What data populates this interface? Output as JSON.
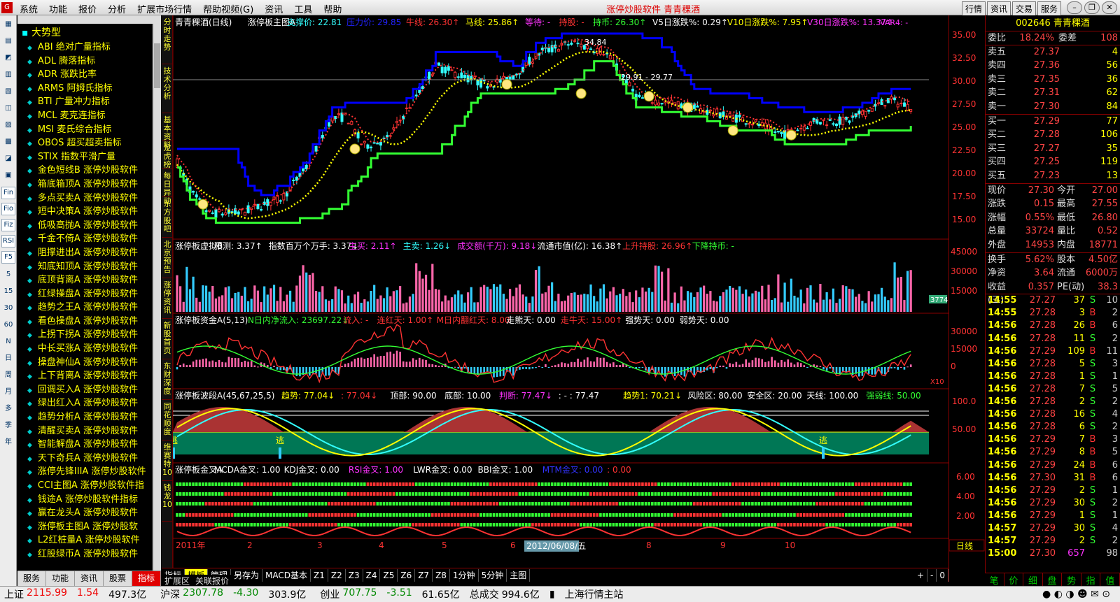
{
  "app": {
    "title": "涨停炒股软件   青青稞酒",
    "menu": [
      "系统",
      "功能",
      "报价",
      "分析",
      "扩展市场行情",
      "帮助视频(G)",
      "资讯",
      "工具",
      "帮助"
    ],
    "right_buttons": [
      "行情",
      "资讯",
      "交易",
      "服务"
    ]
  },
  "sidebar": {
    "header": "大势型",
    "items": [
      "ABI 绝对广量指标",
      "ADL 腾落指标",
      "ADR 涨跌比率",
      "ARMS 阿姆氏指标",
      "BTI 广量冲力指标",
      "MCL 麦克连指标",
      "MSI 麦氏综合指标",
      "OBOS 超买超卖指标",
      "STIX 指数平滑广量",
      "金色短线B 涨停炒股软件",
      "箱底箱顶A 涨停炒股软件",
      "多点买卖A 涨停炒股软件",
      "短中决策A 涨停炒股软件",
      "低吸高抛A 涨停炒股软件",
      "千金不倚A 涨停炒股软件",
      "阻撑进出A 涨停炒股软件",
      "知底知顶A 涨停炒股软件",
      "底顶背离A 涨停炒股软件",
      "红绿操盘A 涨停炒股软件",
      "趋势之王A 涨停炒股软件",
      "看色操盘A 涨停炒股软件",
      "上拐下拐A 涨停炒股软件",
      "中长买涨A 涨停炒股软件",
      "操盘神仙A 涨停炒股软件",
      "上下背离A 涨停炒股软件",
      "回调买入A 涨停炒股软件",
      "绿出红入A 涨停炒股软件",
      "趋势分析A 涨停炒股软件",
      "清醒买卖A 涨停炒股软件",
      "智能解盘A 涨停炒股软件",
      "天下奇兵A 涨停炒股软件",
      "涨停先锋IIIA 涨停炒股软件",
      "CCI主图A 涨停炒股软件指",
      "钱途A 涨停炒股软件指标",
      "赢在龙头A 涨停炒股软件",
      "涨停板主图A 涨停炒股软",
      "L2红桩量A 涨停炒股软件",
      "红股绿币A 涨停炒股软件"
    ],
    "tabs": [
      "服务",
      "功能",
      "资讯",
      "股票",
      "指标"
    ],
    "active_tab": "指标"
  },
  "toolbar": [
    "Fin",
    "Fio",
    "Fiz",
    "RSI",
    "F5",
    "5",
    "15",
    "30",
    "60",
    "N",
    "日",
    "周",
    "月",
    "多",
    "季",
    "年"
  ],
  "vtabs": [
    "分时走势",
    "技术分析",
    "基本资料",
    "龙虎榜",
    "每日异动",
    "东方股吧",
    "北京预告",
    "涨停资讯",
    "新股首页",
    "东财深度",
    "同花顺度",
    "维赛特10",
    "钱龙10"
  ],
  "main_title": {
    "name": "青青稞酒(日线)",
    "indicator": "涨停板主图A",
    "items": [
      {
        "label": "支撑价: 22.81",
        "color": "#3ff"
      },
      {
        "label": "压力价: 29.85",
        "color": "#22f"
      },
      {
        "label": "牛线: 26.30↑",
        "color": "#f33"
      },
      {
        "label": "马线: 25.86↑",
        "color": "#ff0"
      },
      {
        "label": "等待: -",
        "color": "#f3f"
      },
      {
        "label": "持股: -",
        "color": "#f33"
      },
      {
        "label": "持币: 26.30↑",
        "color": "#3f3"
      },
      {
        "label": "V5日涨跌%: 0.29↑",
        "color": "#fff"
      },
      {
        "label": "V10日涨跌%: 7.95↑",
        "color": "#ff0"
      },
      {
        "label": "V30日涨跌%: 13.37↑",
        "color": "#f3f"
      }
    ],
    "var_label": "VAR4: -"
  },
  "annotations": {
    "high": "34.84",
    "mid": "29.91",
    "mid2": "29.77"
  },
  "panel2": {
    "title": "涨停板虚拟B",
    "items": [
      {
        "label": "预测: 3.37↑",
        "color": "#fff"
      },
      {
        "label": "指数百万个万手: 3.37↓",
        "color": "#fff"
      },
      {
        "label": "主买: 2.11↑",
        "color": "#f3f"
      },
      {
        "label": "主卖: 1.26↓",
        "color": "#3ff"
      },
      {
        "label": "成交额(千万): 9.18↓",
        "color": "#f3f"
      },
      {
        "label": "流通市值(亿): 16.38↑",
        "color": "#fff"
      },
      {
        "label": "上升持股: 26.96↑",
        "color": "#f33"
      },
      {
        "label": "下降持币: -",
        "color": "#3f3"
      }
    ],
    "badge": "3774"
  },
  "panel3": {
    "title": "涨停板资金A(5,13)",
    "items": [
      {
        "label": "N日内净流入: 23697.22↓",
        "color": "#3f3"
      },
      {
        "label": "流入: -",
        "color": "#f33"
      },
      {
        "label": "连红天: 1.00↑",
        "color": "#f33"
      },
      {
        "label": "M日内翻红天: 8.00",
        "color": "#f33"
      },
      {
        "label": "走熊天: 0.00",
        "color": "#fff"
      },
      {
        "label": "走牛天: 15.00↑",
        "color": "#f33"
      },
      {
        "label": "强势天: 0.00",
        "color": "#fff"
      },
      {
        "label": "弱势天: 0.00",
        "color": "#fff"
      }
    ],
    "badge": "X10"
  },
  "panel4": {
    "title": "涨停板波段A(45,67,25,5)",
    "items": [
      {
        "label": "趋势: 77.04↓",
        "color": "#ff0"
      },
      {
        "label": ": 77.04↓",
        "color": "#f33"
      },
      {
        "label": "顶部: 90.00",
        "color": "#fff"
      },
      {
        "label": "底部: 10.00",
        "color": "#fff"
      },
      {
        "label": "判断: 77.47↓",
        "color": "#f3f"
      },
      {
        "label": ": - : 77.47",
        "color": "#fff"
      },
      {
        "label": "趋势1: 70.21↓",
        "color": "#ff0"
      },
      {
        "label": "风险区: 80.00",
        "color": "#fff"
      },
      {
        "label": "安全区: 20.00",
        "color": "#fff"
      },
      {
        "label": "天线: 100.00",
        "color": "#fff"
      },
      {
        "label": "强弱线: 50.00",
        "color": "#3f3"
      }
    ],
    "tag": "逃"
  },
  "panel5": {
    "title": "涨停板金叉A",
    "items": [
      {
        "label": "MCDA金叉: 1.00",
        "color": "#fff"
      },
      {
        "label": "KDJ金叉: 0.00",
        "color": "#fff"
      },
      {
        "label": "RSI金叉: 1.00",
        "color": "#f3f"
      },
      {
        "label": "LWR金叉: 0.00",
        "color": "#fff"
      },
      {
        "label": "BBI金叉: 1.00",
        "color": "#fff"
      },
      {
        "label": "MTM金叉: 0.00",
        "color": "#33f"
      },
      {
        "label": ": 0.00",
        "color": "#f33"
      }
    ]
  },
  "xaxis": {
    "year": "2011年",
    "months": [
      "2",
      "3",
      "4",
      "5",
      "6",
      "7",
      "8",
      "9",
      "10"
    ],
    "cursor_date": "2012/06/08/五",
    "period": "日线"
  },
  "yaxis": {
    "main": [
      "35.00",
      "32.50",
      "30.00",
      "27.50",
      "25.00",
      "22.50",
      "20.00",
      "17.50",
      "15.00"
    ],
    "vol": [
      "45000",
      "30000",
      "15000"
    ],
    "fund": [
      "30000",
      "15000",
      "0"
    ],
    "wave": [
      "100.0",
      "50.00"
    ],
    "cross": [
      "6.00",
      "4.00",
      "2.00"
    ]
  },
  "bottomtabs": [
    "指标",
    "模板",
    "管理",
    "另存为",
    "MACD基本",
    "Z1",
    "Z2",
    "Z3",
    "Z4",
    "Z5",
    "Z6",
    "Z7",
    "Z8",
    "1分钟",
    "5分钟",
    "主图"
  ],
  "bottom_left": [
    "扩展区",
    "关联报价"
  ],
  "bottom_right": [
    "+",
    "-",
    "0"
  ],
  "quote": {
    "stock": "002646 青青稞酒",
    "weibi": {
      "label1": "委比",
      "value1": "18.24%",
      "label2": "委差",
      "value2": "108"
    },
    "sell": [
      {
        "label": "卖五",
        "price": "27.37",
        "vol": "4"
      },
      {
        "label": "卖四",
        "price": "27.36",
        "vol": "56"
      },
      {
        "label": "卖三",
        "price": "27.35",
        "vol": "36"
      },
      {
        "label": "卖二",
        "price": "27.31",
        "vol": "62"
      },
      {
        "label": "卖一",
        "price": "27.30",
        "vol": "84"
      }
    ],
    "buy": [
      {
        "label": "买一",
        "price": "27.29",
        "vol": "77"
      },
      {
        "label": "买二",
        "price": "27.28",
        "vol": "106"
      },
      {
        "label": "买三",
        "price": "27.27",
        "vol": "35"
      },
      {
        "label": "买四",
        "price": "27.25",
        "vol": "119"
      },
      {
        "label": "买五",
        "price": "27.23",
        "vol": "13"
      }
    ],
    "info1": [
      {
        "k1": "现价",
        "v1": "27.30",
        "k2": "今开",
        "v2": "27.00"
      },
      {
        "k1": "涨跌",
        "v1": "0.15",
        "k2": "最高",
        "v2": "27.55"
      },
      {
        "k1": "涨幅",
        "v1": "0.55%",
        "k2": "最低",
        "v2": "26.80"
      },
      {
        "k1": "总量",
        "v1": "33724",
        "k2": "量比",
        "v2": "0.52"
      },
      {
        "k1": "外盘",
        "v1": "14953",
        "k2": "内盘",
        "v2": "18771"
      }
    ],
    "info2": [
      {
        "k1": "换手",
        "v1": "5.62%",
        "k2": "股本",
        "v2": "4.50亿"
      },
      {
        "k1": "净资",
        "v1": "3.64",
        "k2": "流通",
        "v2": "6000万"
      },
      {
        "k1": "收益(三)",
        "v1": "0.357",
        "k2": "PE(动)",
        "v2": "38.3"
      }
    ],
    "ticks": [
      {
        "t": "14:55",
        "p": "27.27",
        "v": "37",
        "s": "S",
        "n": "10"
      },
      {
        "t": "14:55",
        "p": "27.28",
        "v": "3",
        "s": "B",
        "n": "2"
      },
      {
        "t": "14:56",
        "p": "27.28",
        "v": "26",
        "s": "B",
        "n": "6"
      },
      {
        "t": "14:56",
        "p": "27.28",
        "v": "11",
        "s": "S",
        "n": "2"
      },
      {
        "t": "14:56",
        "p": "27.29",
        "v": "109",
        "s": "B",
        "n": "11"
      },
      {
        "t": "14:56",
        "p": "27.28",
        "v": "5",
        "s": "S",
        "n": "3"
      },
      {
        "t": "14:56",
        "p": "27.28",
        "v": "1",
        "s": "S",
        "n": "1"
      },
      {
        "t": "14:56",
        "p": "27.28",
        "v": "7",
        "s": "S",
        "n": "5"
      },
      {
        "t": "14:56",
        "p": "27.28",
        "v": "2",
        "s": "S",
        "n": "2"
      },
      {
        "t": "14:56",
        "p": "27.28",
        "v": "16",
        "s": "S",
        "n": "4"
      },
      {
        "t": "14:56",
        "p": "27.28",
        "v": "6",
        "s": "S",
        "n": "2"
      },
      {
        "t": "14:56",
        "p": "27.29",
        "v": "7",
        "s": "B",
        "n": "3"
      },
      {
        "t": "14:56",
        "p": "27.29",
        "v": "8",
        "s": "B",
        "n": "5"
      },
      {
        "t": "14:56",
        "p": "27.29",
        "v": "24",
        "s": "B",
        "n": "6"
      },
      {
        "t": "14:56",
        "p": "27.30",
        "v": "31",
        "s": "B",
        "n": "6"
      },
      {
        "t": "14:56",
        "p": "27.29",
        "v": "2",
        "s": "S",
        "n": "1"
      },
      {
        "t": "14:56",
        "p": "27.29",
        "v": "30",
        "s": "S",
        "n": "2"
      },
      {
        "t": "14:56",
        "p": "27.29",
        "v": "1",
        "s": "S",
        "n": "1"
      },
      {
        "t": "14:57",
        "p": "27.29",
        "v": "30",
        "s": "S",
        "n": "4"
      },
      {
        "t": "14:57",
        "p": "27.29",
        "v": "2",
        "s": "S",
        "n": "2"
      },
      {
        "t": "15:00",
        "p": "27.30",
        "v": "657",
        "s": "",
        "n": "98"
      }
    ],
    "tabs": [
      "笔",
      "价",
      "细",
      "盘",
      "势",
      "指",
      "值"
    ]
  },
  "status": {
    "items": [
      {
        "label": "上证",
        "value": "2115.99",
        "chg": "1.54",
        "amt": "497.3亿",
        "color": "#e00"
      },
      {
        "label": "沪深",
        "value": "2307.78",
        "chg": "-4.30",
        "amt": "303.9亿",
        "color": "#080"
      },
      {
        "label": "创业",
        "value": "707.75",
        "chg": "-3.51",
        "amt": "61.65亿",
        "color": "#080"
      }
    ],
    "total_label": "总成交",
    "total": "994.6亿",
    "server": "上海行情主站"
  }
}
